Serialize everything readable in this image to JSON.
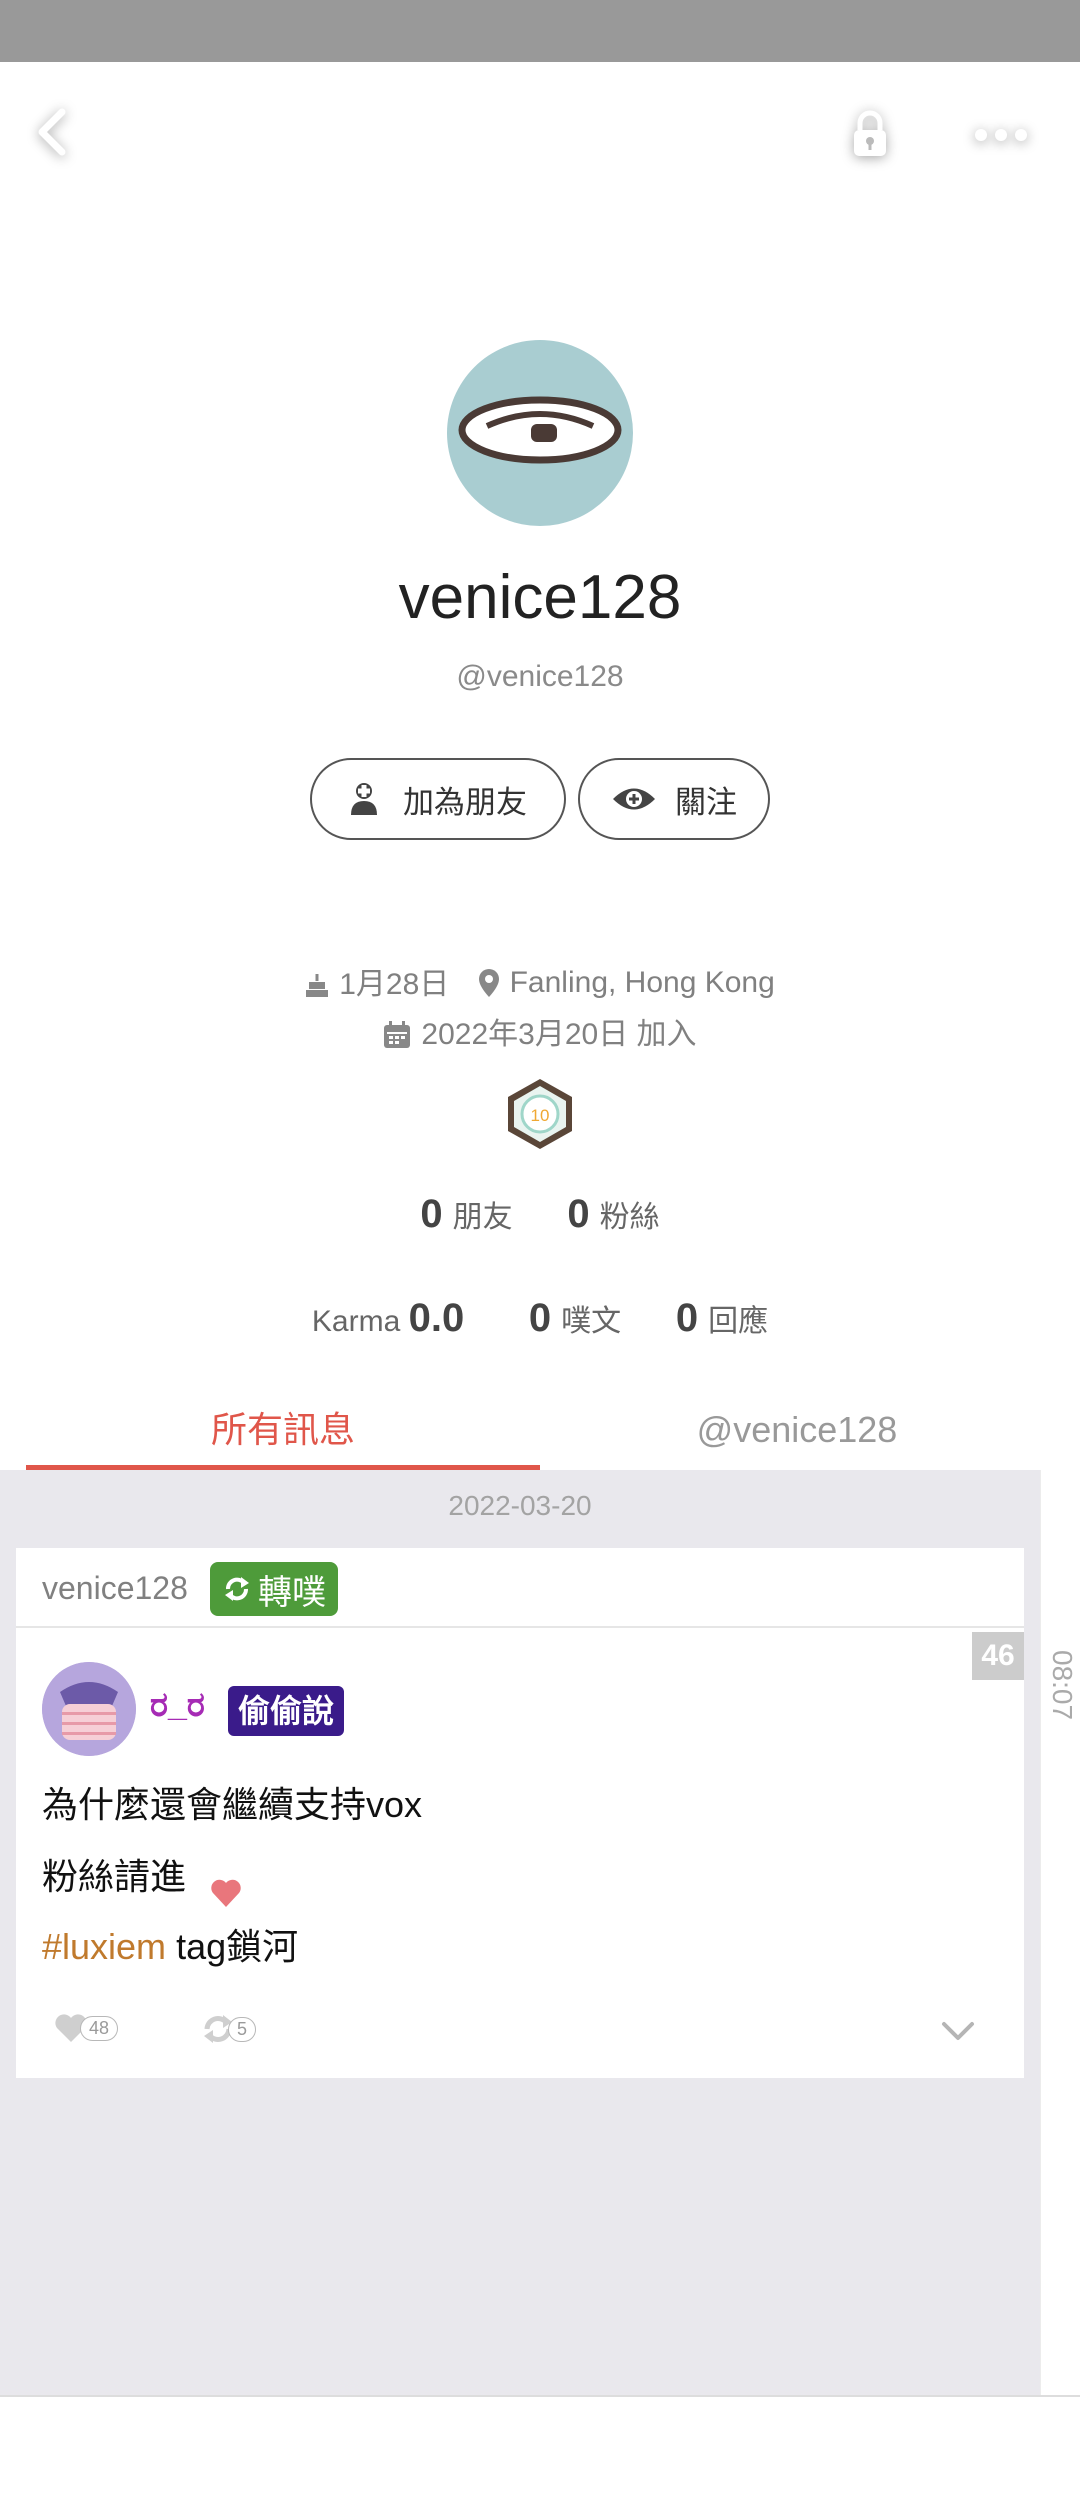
{
  "profile": {
    "display_name": "venice128",
    "handle": "@venice128",
    "add_friend_label": "加為朋友",
    "follow_label": "關注",
    "birthday": "1月28日",
    "location": "Fanling, Hong Kong",
    "joined": "2022年3月20日 加入",
    "badge_level": "10"
  },
  "stats": {
    "friends_count": "0",
    "friends_label": "朋友",
    "fans_count": "0",
    "fans_label": "粉絲",
    "karma_label": "Karma",
    "karma_value": "0.0",
    "plurks_count": "0",
    "plurks_label": "噗文",
    "responses_count": "0",
    "responses_label": "回應"
  },
  "tabs": {
    "all": "所有訊息",
    "mentions": "@venice128"
  },
  "feed": {
    "date": "2022-03-20",
    "time": "08:07",
    "repost_user": "venice128",
    "repost_label": "轉噗",
    "response_count": "46",
    "poster_name": "ರ_ರ",
    "poster_tag": "偷偷說",
    "line1": "為什麼還會繼續支持vox",
    "line2": "粉絲請進",
    "hashtag": "#luxiem",
    "line3_rest": " tag鎖河",
    "likes": "48",
    "replurks": "5"
  },
  "colors": {
    "accent": "#e0564a",
    "repost_green": "#4e9b3a",
    "secret_tag": "#3a1b8a",
    "hashtag": "#c07a2d"
  }
}
